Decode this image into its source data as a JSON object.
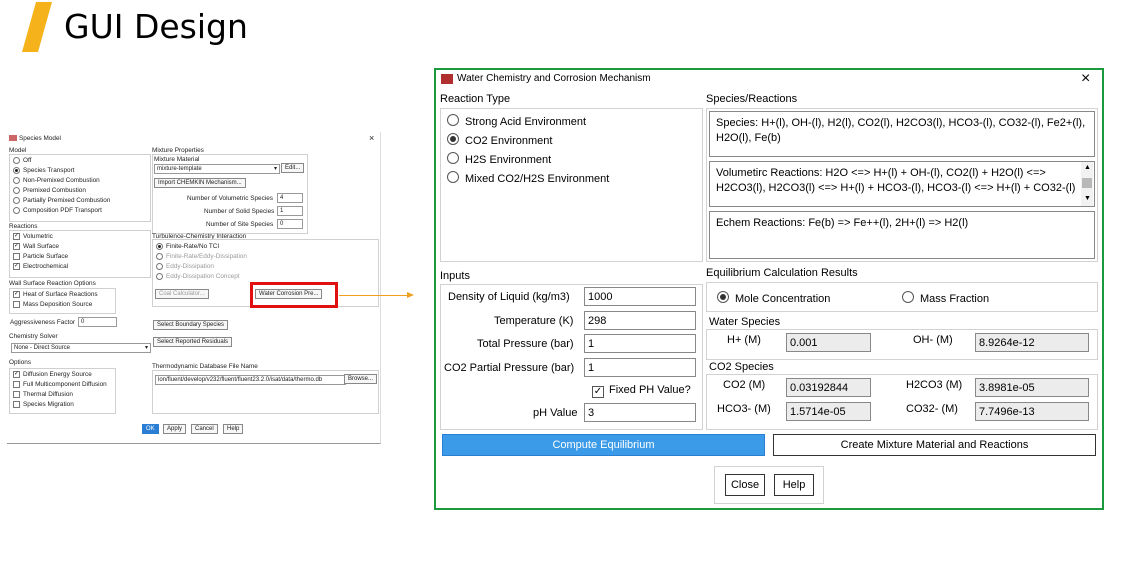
{
  "slide": {
    "title": "GUI Design",
    "accent": "#f6b21a"
  },
  "species_model": {
    "title": "Species Model",
    "model": {
      "header": "Model",
      "options": [
        "Off",
        "Species Transport",
        "Non-Premixed Combustion",
        "Premixed Combustion",
        "Partially Premixed Combustion",
        "Composition PDF Transport"
      ],
      "selected": "Species Transport"
    },
    "reactions": {
      "header": "Reactions",
      "options": [
        "Volumetric",
        "Wall Surface",
        "Particle Surface",
        "Electrochemical"
      ],
      "checked": [
        "Volumetric",
        "Wall Surface",
        "Electrochemical"
      ]
    },
    "wall_surface": {
      "header": "Wall Surface Reaction Options",
      "options": [
        "Heat of Surface Reactions",
        "Mass Deposition Source"
      ],
      "checked": [
        "Heat of Surface Reactions"
      ]
    },
    "aggressiveness": {
      "label": "Aggressiveness Factor",
      "value": "0"
    },
    "chemistry_solver": {
      "header": "Chemistry Solver",
      "value": "None - Direct Source"
    },
    "options": {
      "header": "Options",
      "items": [
        "Diffusion Energy Source",
        "Full Multicomponent Diffusion",
        "Thermal Diffusion",
        "Species Migration"
      ],
      "checked": [
        "Diffusion Energy Source"
      ]
    },
    "mixture": {
      "header": "Mixture Properties",
      "material_label": "Mixture Material",
      "material_value": "mixture-template",
      "edit": "Edit...",
      "import": "Import CHEMKIN Mechanism...",
      "counts": [
        {
          "label": "Number of Volumetric Species",
          "value": "4"
        },
        {
          "label": "Number of Solid Species",
          "value": "1"
        },
        {
          "label": "Number of Site Species",
          "value": "0"
        }
      ]
    },
    "tci": {
      "header": "Turbulence-Chemistry Interaction",
      "options": [
        "Finite-Rate/No TCI",
        "Finite-Rate/Eddy-Dissipation",
        "Eddy-Dissipation",
        "Eddy-Dissipation Concept"
      ],
      "selected": "Finite-Rate/No TCI"
    },
    "coal_calc": "Coal Calculator...",
    "water_corrosion": "Water Corrosion Pre...",
    "select_boundary": "Select Boundary Species",
    "select_residuals": "Select Reported Residuals",
    "thermo": {
      "label": "Thermodynamic Database File Name",
      "value": "lon/fluent/develop/v232/fluent/fluent23.2.0/isat/data/thermo.db",
      "browse": "Browse..."
    },
    "buttons": [
      "OK",
      "Apply",
      "Cancel",
      "Help"
    ]
  },
  "dialog": {
    "title": "Water Chemistry and Corrosion Mechanism",
    "reaction_type": {
      "header": "Reaction Type",
      "options": [
        "Strong Acid Environment",
        "CO2 Environment",
        "H2S Environment",
        "Mixed CO2/H2S Environment"
      ],
      "selected": "CO2 Environment"
    },
    "species_reactions": {
      "header": "Species/Reactions",
      "species": "Species: H+(l), OH-(l), H2(l), CO2(l), H2CO3(l), HCO3-(l), CO32-(l), Fe2+(l), H2O(l), Fe(b)",
      "volumetric": "Volumetirc Reactions: H2O <=> H+(l) + OH-(l), CO2(l) + H2O(l) <=> H2CO3(l), H2CO3(l) <=> H+(l) + HCO3-(l), HCO3-(l) <=> H+(l) + CO32-(l)",
      "echem": "Echem Reactions: Fe(b) => Fe++(l), 2H+(l) => H2(l)"
    },
    "inputs": {
      "header": "Inputs",
      "density_label": "Density of Liquid (kg/m3)",
      "density": "1000",
      "temperature_label": "Temperature (K)",
      "temperature": "298",
      "pressure_label": "Total Pressure (bar)",
      "pressure": "1",
      "co2_label": "CO2 Partial Pressure (bar)",
      "co2": "1",
      "fixed_ph_label": "Fixed PH Value?",
      "ph_label": "pH Value",
      "ph": "3"
    },
    "results": {
      "header": "Equilibrium Calculation Results",
      "mode_options": [
        "Mole Concentration",
        "Mass Fraction"
      ],
      "mode_selected": "Mole Concentration",
      "water_header": "Water Species",
      "h_label": "H+ (M)",
      "h": "0.001",
      "oh_label": "OH- (M)",
      "oh": "8.9264e-12",
      "co2_header": "CO2 Species",
      "co2_label": "CO2 (M)",
      "co2": "0.03192844",
      "h2co3_label": "H2CO3 (M)",
      "h2co3": "3.8981e-05",
      "hco3_label": "HCO3- (M)",
      "hco3": "1.5714e-05",
      "co32_label": "CO32- (M)",
      "co32": "7.7496e-13"
    },
    "compute_btn": "Compute Equilibrium",
    "create_btn": "Create Mixture Material and Reactions",
    "close_btn": "Close",
    "help_btn": "Help",
    "close_icon": "×",
    "colors": {
      "frame": "#1a9a3c",
      "primary": "#3b9be8",
      "highlight": "#e01010",
      "arrow": "#f0a020"
    }
  }
}
